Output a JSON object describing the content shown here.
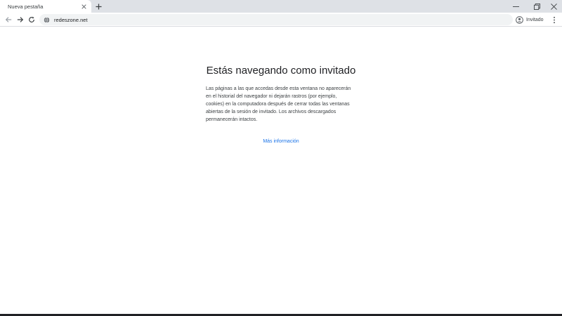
{
  "tab": {
    "title": "Nueva pestaña"
  },
  "toolbar": {
    "url": "redeszone.net"
  },
  "profile": {
    "label": "Invitado"
  },
  "content": {
    "heading": "Estás navegando como invitado",
    "description": "Las páginas a las que accedas desde esta ventana no aparecerán en el historial del navegador ni dejarán rastros (por ejemplo, cookies) en la computadora después de cerrar todas las ventanas abiertas de la sesión de invitado. Los archivos descargados permanecerán intactos.",
    "link": "Más información"
  },
  "icons": {
    "close": "close-icon",
    "new_tab": "plus-icon",
    "back": "arrow-left-icon",
    "forward": "arrow-right-icon",
    "reload": "reload-icon",
    "site_info": "globe-icon",
    "profile": "account-icon",
    "menu": "kebab-menu-icon"
  },
  "colors": {
    "link": "#1a73e8",
    "tabstrip": "#dee1e6",
    "omnibox": "#f1f3f4"
  }
}
